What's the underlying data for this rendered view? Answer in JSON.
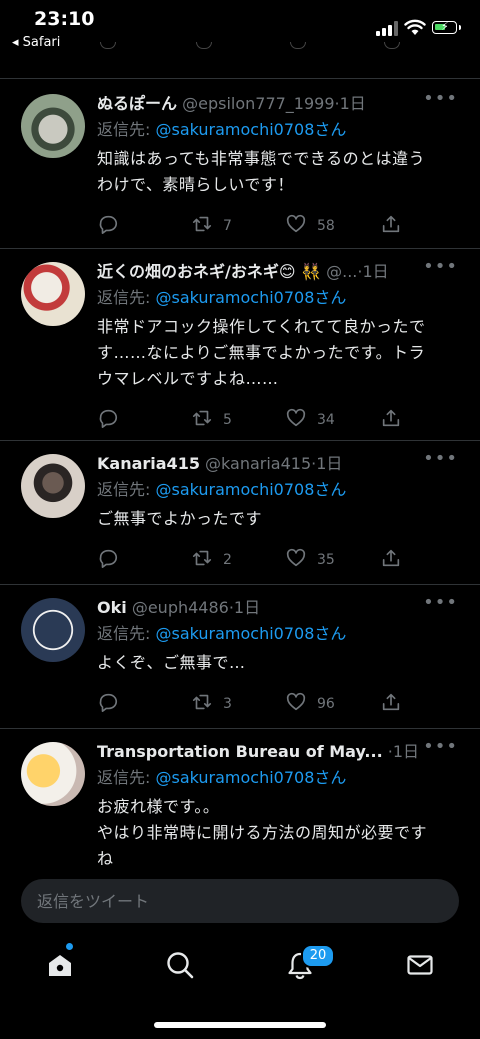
{
  "status_bar": {
    "time": "23:10",
    "back_app": "◂ Safari"
  },
  "tweets": [
    {
      "name": "ぬるぽーん",
      "handle": "@epsilon777_1999",
      "age": "1日",
      "reply_label": "返信先: ",
      "reply_to": "@sakuramochi0708さん",
      "body": [
        "知識はあっても非常事態でできるのとは違う",
        "わけで、素晴らしいです！"
      ],
      "replies": "",
      "retweets": "7",
      "likes": "58"
    },
    {
      "name": "近くの畑のおネギ/おネギ😊 👯",
      "handle": "@...",
      "age": "1日",
      "reply_label": "返信先: ",
      "reply_to": "@sakuramochi0708さん",
      "body": [
        "非常ドアコック操作してくれてて良かったで",
        "す……なによりご無事でよかったです。トラ",
        "ウマレベルですよね……"
      ],
      "replies": "",
      "retweets": "5",
      "likes": "34"
    },
    {
      "name": "Kanaria415",
      "handle": "@kanaria415",
      "age": "1日",
      "reply_label": "返信先: ",
      "reply_to": "@sakuramochi0708さん",
      "body": [
        "ご無事でよかったです"
      ],
      "replies": "",
      "retweets": "2",
      "likes": "35"
    },
    {
      "name": "Oki",
      "handle": "@euph4486",
      "age": "1日",
      "reply_label": "返信先: ",
      "reply_to": "@sakuramochi0708さん",
      "body": [
        "よくぞ、ご無事で…"
      ],
      "replies": "",
      "retweets": "3",
      "likes": "96"
    },
    {
      "name": "Transportation Bureau of May...",
      "handle": "",
      "age": "1日",
      "reply_label": "返信先: ",
      "reply_to": "@sakuramochi0708さん",
      "body": [
        "お疲れ様です。。",
        "やはり非常時に開ける方法の周知が必要です",
        "ね"
      ],
      "replies": "",
      "retweets": "",
      "likes": ""
    }
  ],
  "composer": {
    "placeholder": "返信をツイート"
  },
  "tabbar": {
    "notifications_badge": "20"
  },
  "colors": {
    "accent": "#1d9bf0",
    "background": "#000000",
    "muted": "#71767b",
    "divider": "#2f3336"
  },
  "icons": [
    "reply-icon",
    "retweet-icon",
    "like-icon",
    "share-icon",
    "more-icon",
    "home-icon",
    "search-icon",
    "bell-icon",
    "mail-icon"
  ]
}
